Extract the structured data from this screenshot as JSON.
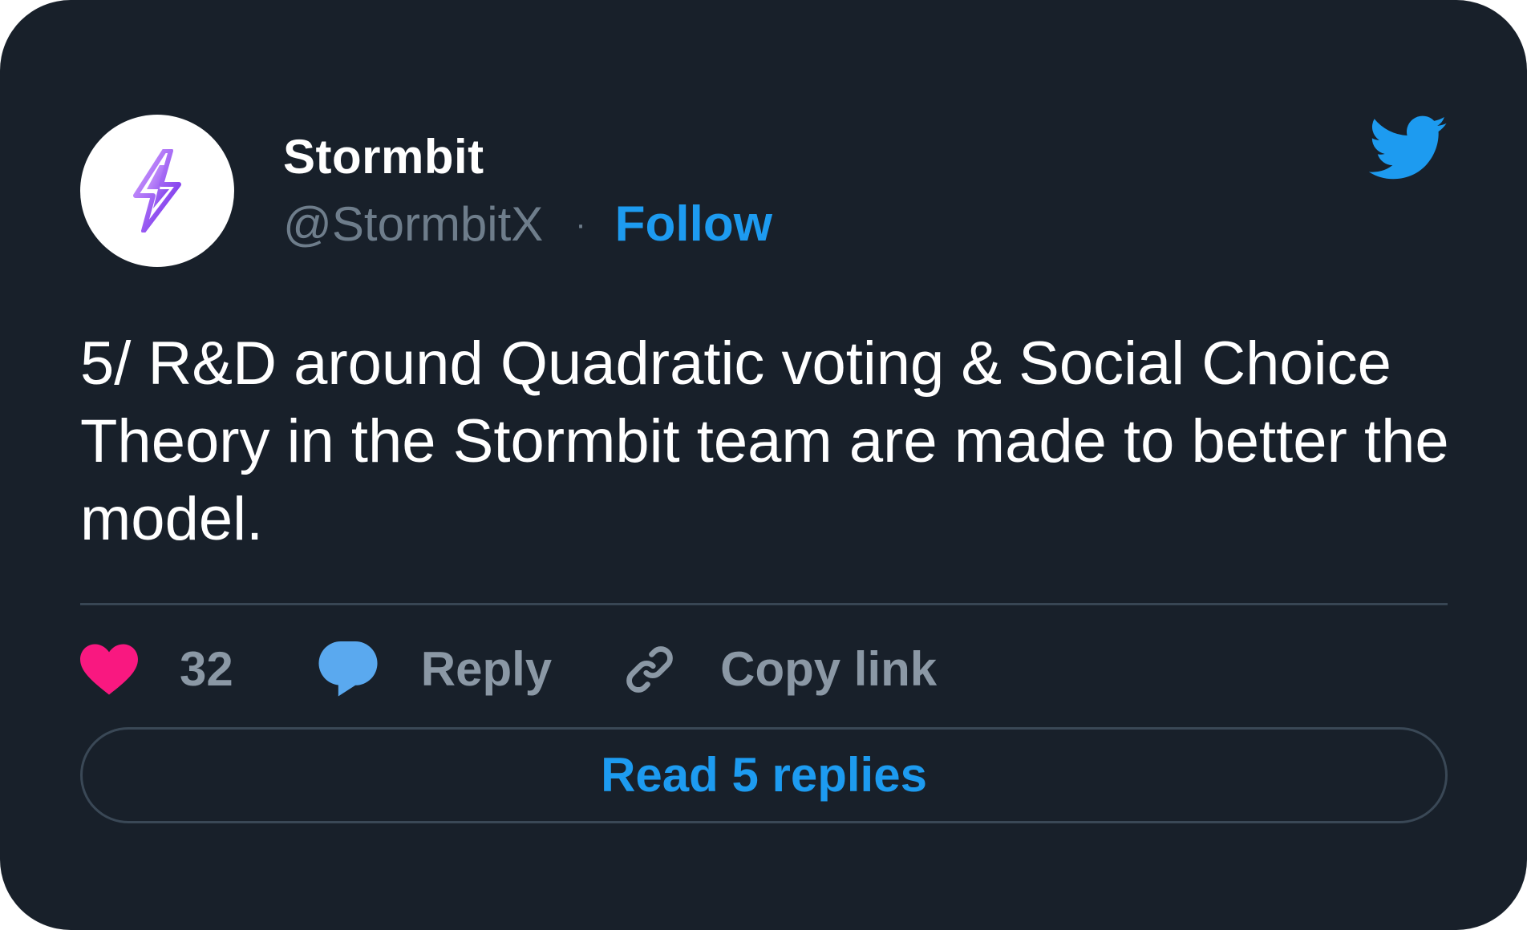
{
  "author": {
    "display_name": "Stormbit",
    "handle": "@StormbitX",
    "separator": "·",
    "follow_label": "Follow",
    "avatar_icon": "lightning-bolt-icon"
  },
  "tweet": {
    "text": "5/ R&D around Quadratic voting & Social Choice Theory in the Stormbit team are made to better the model."
  },
  "actions": {
    "like_count": "32",
    "reply_label": "Reply",
    "copy_link_label": "Copy link"
  },
  "footer": {
    "read_replies_label": "Read 5 replies"
  },
  "colors": {
    "background": "#18202a",
    "accent": "#1d9bf0",
    "like": "#f91880",
    "muted": "#8b98a5",
    "bolt_gradient": [
      "#c58cff",
      "#6a22e8"
    ]
  },
  "icons": [
    "twitter-bird-icon",
    "heart-icon",
    "speech-bubble-icon",
    "link-icon"
  ]
}
